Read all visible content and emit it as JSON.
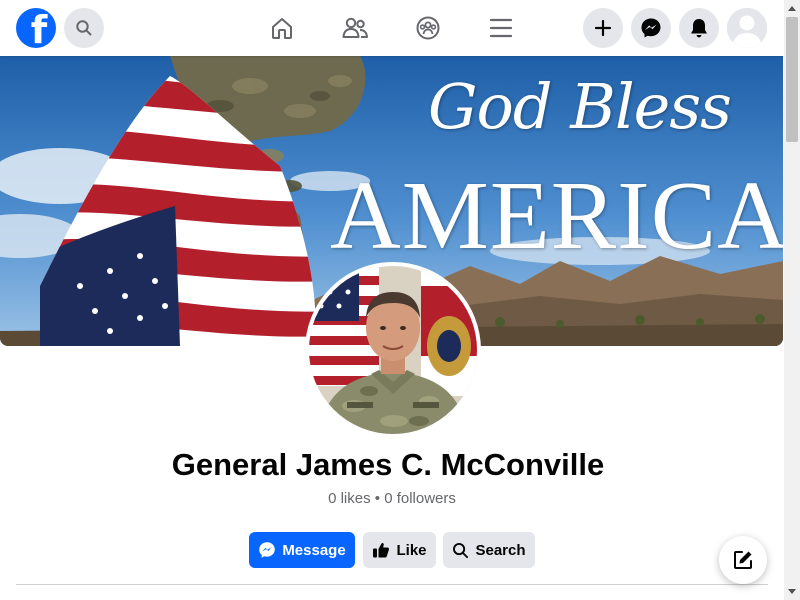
{
  "topbar": {
    "logo_letter": "f",
    "icons": {
      "search": "search-icon",
      "home": "home-icon",
      "friends": "friends-icon",
      "groups": "groups-icon",
      "menu": "menu-icon",
      "create": "plus-icon",
      "messenger": "messenger-icon",
      "notifications": "bell-icon",
      "account": "avatar-icon"
    }
  },
  "cover": {
    "line1": "God Bless",
    "line2": "AMERICA"
  },
  "profile": {
    "name": "General James C. McConville",
    "stats": "0 likes • 0 followers"
  },
  "actions": {
    "message": "Message",
    "like": "Like",
    "search": "Search"
  },
  "colors": {
    "brand_blue": "#0866ff",
    "button_gray": "#e4e6eb",
    "secondary_text": "#65676b"
  }
}
